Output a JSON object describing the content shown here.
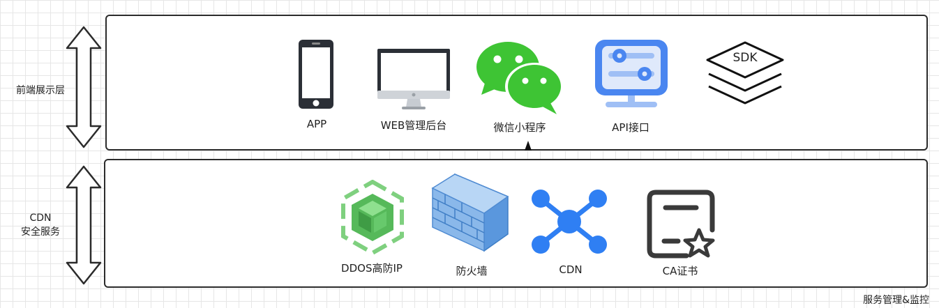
{
  "layers": {
    "frontend": {
      "side_label": "前端展示层",
      "items": [
        {
          "label": "APP",
          "icon": "smartphone-icon"
        },
        {
          "label": "WEB管理后台",
          "icon": "monitor-icon"
        },
        {
          "label": "微信小程序",
          "icon": "wechat-icon"
        },
        {
          "label": "API接口",
          "icon": "api-panel-icon"
        },
        {
          "label": "",
          "icon": "sdk-layers-icon",
          "icon_text": "SDK"
        }
      ]
    },
    "cdn": {
      "side_label_line1": "CDN",
      "side_label_line2": "安全服务",
      "items": [
        {
          "label": "DDOS高防IP",
          "icon": "ddos-shield-cube-icon"
        },
        {
          "label": "防火墙",
          "icon": "firewall-icon"
        },
        {
          "label": "CDN",
          "icon": "cdn-network-icon"
        },
        {
          "label": "CA证书",
          "icon": "certificate-icon"
        }
      ]
    }
  },
  "footer": "服务管理&监控",
  "colors": {
    "wechat_green": "#3ec434",
    "api_blue": "#4a86f0",
    "cdn_blue": "#2f7ff3",
    "firewall_blue": "#8ab8ea",
    "ddos_green": "#56b95a",
    "outline": "#2b2b2b"
  }
}
